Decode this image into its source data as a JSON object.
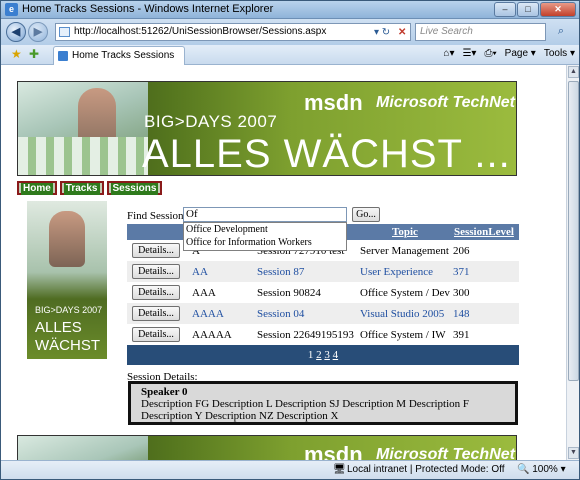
{
  "window": {
    "title": "Home Tracks Sessions - Windows Internet Explorer",
    "minimize": "–",
    "maximize": "□",
    "close": "✕"
  },
  "address_bar": {
    "url": "http://localhost:51262/UniSessionBrowser/Sessions.aspx",
    "search_placeholder": "Live Search"
  },
  "tab": {
    "title": "Home Tracks Sessions"
  },
  "toolbar": {
    "page_label": "Page",
    "tools_label": "Tools"
  },
  "banner": {
    "event": "BIG>DAYS 2007",
    "headline": "ALLES WÄCHST ...",
    "msdn": "msdn",
    "technet": "Microsoft TechNet"
  },
  "nav": {
    "home": "Home",
    "tracks": "Tracks",
    "sessions": "Sessions"
  },
  "side_banner": {
    "event": "BIG>DAYS 2007",
    "line1": "ALLES",
    "line2": "WÄCHST"
  },
  "find": {
    "label": "Find Session:",
    "value": "Of",
    "go_label": "Go..."
  },
  "autocomplete": [
    "Office Development",
    "Office for Information Workers"
  ],
  "grid": {
    "headers": {
      "topic": "Topic",
      "level": "SessionLevel"
    },
    "details_label": "Details...",
    "rows": [
      {
        "speaker": "A",
        "session": "Session 727910 test",
        "topic": "Server Management",
        "level": "206"
      },
      {
        "speaker": "AA",
        "session": "Session 87",
        "topic": "User Experience",
        "level": "371"
      },
      {
        "speaker": "AAA",
        "session": "Session 90824",
        "topic": "Office System / Dev",
        "level": "300"
      },
      {
        "speaker": "AAAA",
        "session": "Session 04",
        "topic": "Visual Studio 2005",
        "level": "148"
      },
      {
        "speaker": "AAAAA",
        "session": "Session 22649195193",
        "topic": "Office System / IW",
        "level": "391"
      }
    ],
    "pager": {
      "current": "1",
      "pages": [
        "2",
        "3",
        "4"
      ]
    }
  },
  "session_details": {
    "label": "Session Details:",
    "speaker": "Speaker 0",
    "description": "Description FG Description L Description SJ Description M Description F Description Y Description NZ Description X"
  },
  "status": {
    "zone": "Local intranet | Protected Mode: Off",
    "zoom": "100%"
  }
}
